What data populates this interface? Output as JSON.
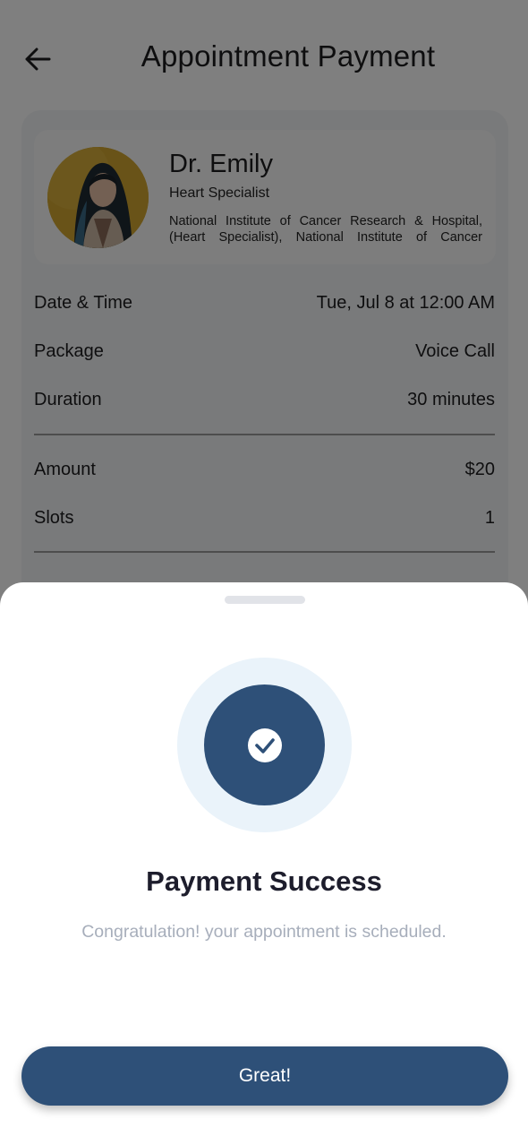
{
  "header": {
    "title": "Appointment Payment",
    "back_icon": "arrow-left-icon"
  },
  "doctor": {
    "name": "Dr. Emily",
    "specialty": "Heart Specialist",
    "institute": "National Institute of Cancer Research & Hospital, (Heart Specialist), National Institute of Cancer Research & Hospital"
  },
  "details": {
    "date_time_label": "Date & Time",
    "date_time_value": "Tue, Jul 8 at 12:00 AM",
    "package_label": "Package",
    "package_value": "Voice Call",
    "duration_label": "Duration",
    "duration_value": "30 minutes",
    "amount_label": "Amount",
    "amount_value": "$20",
    "slots_label": "Slots",
    "slots_value": "1"
  },
  "sheet": {
    "title": "Payment Success",
    "message": "Congratulation! your appointment is scheduled.",
    "button_label": "Great!",
    "success_icon": "check-icon"
  },
  "colors": {
    "primary": "#2e5078",
    "success_ring": "#eaf3fa",
    "message_text": "#a7aebb"
  }
}
